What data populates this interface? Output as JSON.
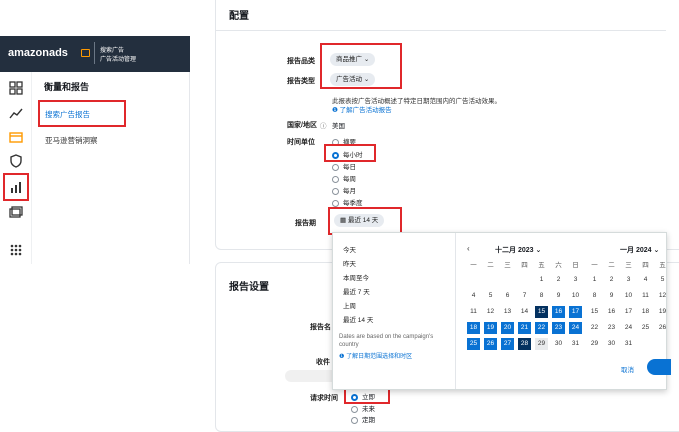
{
  "sidebar": {
    "brand": "amazonads",
    "product_line1": "搜索广告",
    "product_line2": "广告活动管理",
    "section_title": "衡量和报告",
    "items": [
      {
        "label": "搜索广告报告"
      },
      {
        "label": "亚马逊营销洞察"
      }
    ]
  },
  "config": {
    "title": "配置",
    "report_category_label": "报告品类",
    "report_category_value": "商品推广",
    "report_type_label": "报告类型",
    "report_type_value": "广告活动",
    "report_type_desc": "此报表按广告活动概述了特定日期范围内的广告活动效果。",
    "learn_link": "了解广告活动报告",
    "country_label": "国家/地区",
    "country_value": "美国",
    "time_unit_label": "时间单位",
    "time_units": [
      "摘要",
      "每小时",
      "每日",
      "每周",
      "每月",
      "每季度"
    ],
    "time_unit_selected": "每小时",
    "period_label": "报告期",
    "period_value": "最近 14 天"
  },
  "datepicker": {
    "presets": [
      "今天",
      "昨天",
      "本周至今",
      "最近 7 天",
      "上周",
      "最近 14 天"
    ],
    "note": "Dates are based on the campaign's country",
    "link": "了解日期范围选择和时区",
    "left_month": "十二月 2023",
    "right_month": "一月 2024",
    "weekdays": [
      "一",
      "二",
      "三",
      "四",
      "五",
      "六",
      "日"
    ],
    "right_weekdays": [
      "一",
      "二",
      "三",
      "四",
      "五"
    ],
    "left_weeks": [
      [
        "",
        "",
        "",
        "",
        "1",
        "2",
        "3"
      ],
      [
        "4",
        "5",
        "6",
        "7",
        "8",
        "9",
        "10"
      ],
      [
        "11",
        "12",
        "13",
        "14",
        "15",
        "16",
        "17"
      ],
      [
        "18",
        "19",
        "20",
        "21",
        "22",
        "23",
        "24"
      ],
      [
        "25",
        "26",
        "27",
        "28",
        "29",
        "30",
        "31"
      ]
    ],
    "right_weeks": [
      [
        "1",
        "2",
        "3",
        "4",
        "5"
      ],
      [
        "8",
        "9",
        "10",
        "11",
        "12"
      ],
      [
        "15",
        "16",
        "17",
        "18",
        "19"
      ],
      [
        "22",
        "23",
        "24",
        "25",
        "26"
      ],
      [
        "29",
        "30",
        "31",
        "",
        ""
      ]
    ],
    "cancel": "取消"
  },
  "settings": {
    "title": "报告设置",
    "name_label": "报告名",
    "recipient_label": "收件",
    "request_time_label": "请求时间",
    "request_options": [
      "立即",
      "未来",
      "定期"
    ],
    "request_selected": "立即"
  },
  "colors": {
    "primary": "#0972d3",
    "dark": "#033160",
    "navy": "#232f3e",
    "highlight": "#e0282b"
  }
}
